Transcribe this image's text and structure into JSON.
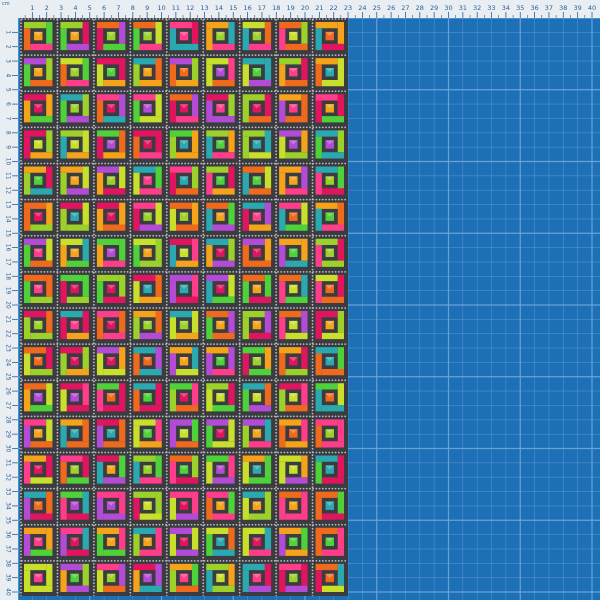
{
  "image": {
    "subject": "rhinestone-mosaic-sheet-on-cutting-mat",
    "ruler": {
      "unit_label": "cm",
      "top_ticks": [
        "1",
        "2",
        "3",
        "4",
        "5",
        "6",
        "7",
        "8",
        "9",
        "10",
        "11",
        "12",
        "13",
        "14",
        "15",
        "16",
        "17",
        "18",
        "19",
        "20",
        "21",
        "22",
        "23",
        "24",
        "25",
        "26",
        "27",
        "28",
        "29",
        "30",
        "31",
        "32",
        "33",
        "34",
        "35",
        "36",
        "37",
        "38",
        "39",
        "40"
      ],
      "left_ticks": [
        "1",
        "2",
        "3",
        "4",
        "5",
        "6",
        "7",
        "8",
        "9",
        "10",
        "11",
        "12",
        "13",
        "14",
        "15",
        "16",
        "17",
        "18",
        "19",
        "20",
        "21",
        "22",
        "23",
        "24",
        "25",
        "26",
        "27",
        "28",
        "29",
        "30",
        "31",
        "32",
        "33",
        "34",
        "35",
        "36",
        "37",
        "38",
        "39",
        "40"
      ]
    },
    "mosaic": {
      "columns": 9,
      "rows": 16,
      "palette": [
        "#e0145f",
        "#ff3d8a",
        "#f06a1e",
        "#f5a31a",
        "#9bd12a",
        "#4fd13a",
        "#c8e02b",
        "#b44bd6",
        "#2aa9b0"
      ]
    },
    "colors": {
      "mat": "#1d6fb6",
      "mat_grid": "#6fa8dc",
      "ruler_bg": "#e9eef3",
      "ruler_text": "#2c5f8f",
      "mesh": "#3a3c40"
    }
  }
}
